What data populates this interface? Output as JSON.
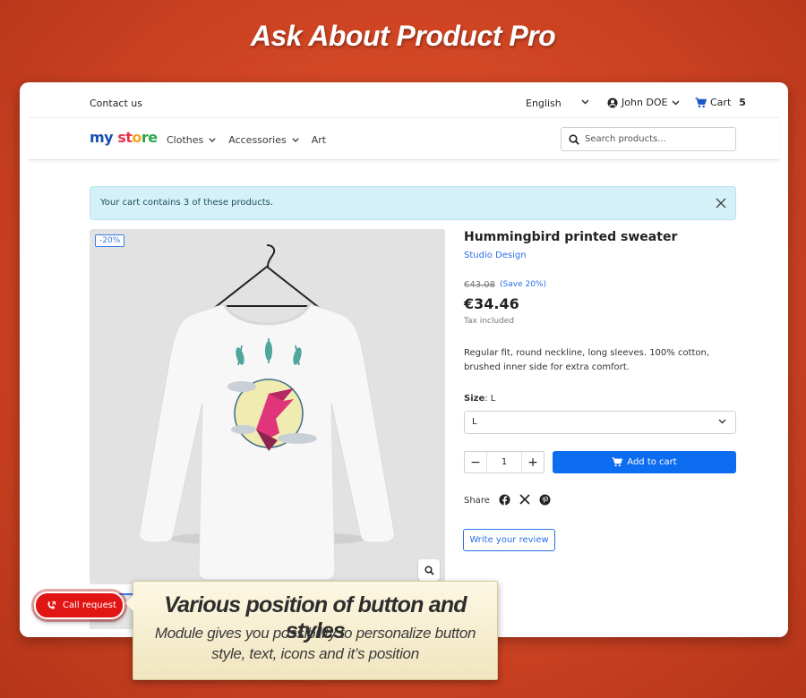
{
  "headline": "Ask About Product Pro",
  "topbar": {
    "contact": "Contact us",
    "language": "English",
    "user": "John DOE",
    "cart_label": "Cart",
    "cart_count": "5"
  },
  "navbar": {
    "logo": {
      "part1": "my",
      "part2": "st",
      "part3": "o",
      "part4": "re"
    },
    "menu": [
      "Clothes",
      "Accessories",
      "Art"
    ],
    "search_placeholder": "Search products..."
  },
  "alert": {
    "text": "Your cart contains 3 of these products."
  },
  "product": {
    "discount_badge": "-20%",
    "title": "Hummingbird printed sweater",
    "brand": "Studio Design",
    "old_price": "€43.08",
    "save": "(Save 20%)",
    "price": "€34.46",
    "tax": "Tax included",
    "description": "Regular fit, round neckline, long sleeves. 100% cotton, brushed inner side for extra comfort.",
    "size_label": "Size",
    "size_value": "L",
    "size_selected": "L",
    "quantity": "1",
    "add_to_cart": "Add to cart",
    "share_label": "Share",
    "share_icons": [
      "facebook-icon",
      "x-icon",
      "pinterest-icon"
    ],
    "review_button": "Write your review"
  },
  "call_button": {
    "label": "Call request",
    "color": "#e21515"
  },
  "callout": {
    "heading": "Various position of button and styles",
    "subtext_line1": "Module gives you possibility to personalize button",
    "subtext_line2": "style, text, icons and it’s position"
  },
  "colors": {
    "accent": "#0c6df0",
    "background": "#cf4423",
    "alert_bg": "#d4f1f9"
  }
}
